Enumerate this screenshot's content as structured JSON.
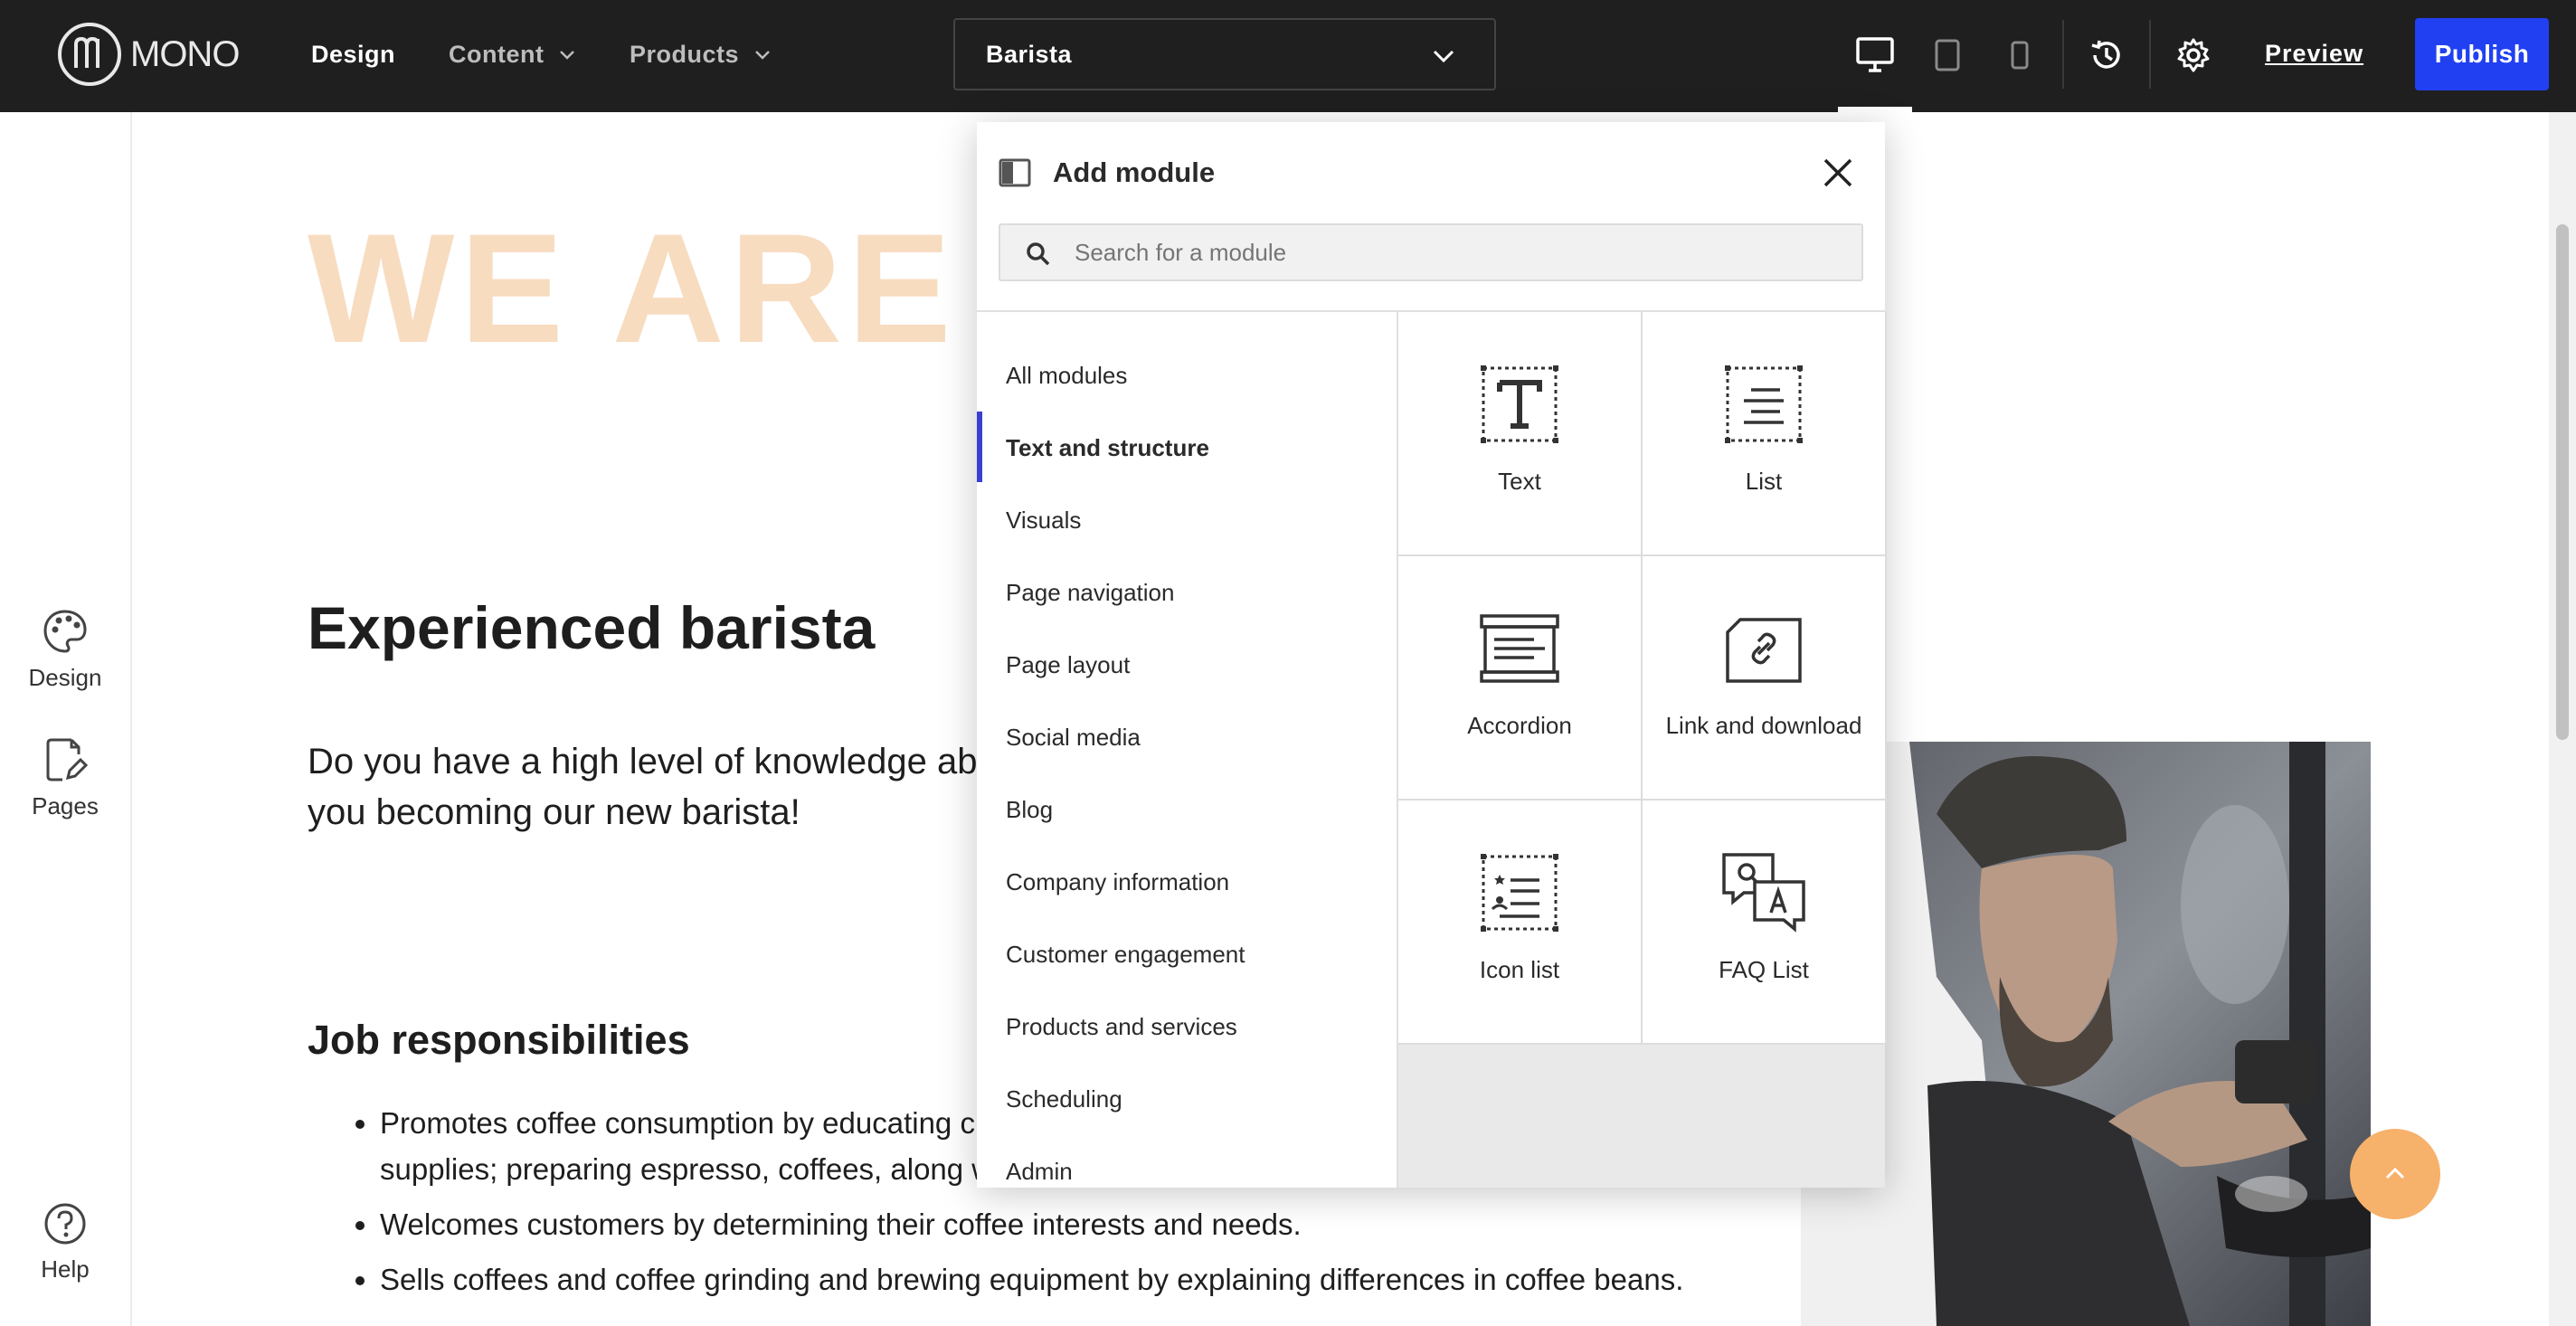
{
  "topbar": {
    "logo_text": "MONO",
    "nav": [
      {
        "label": "Design"
      },
      {
        "label": "Content"
      },
      {
        "label": "Products"
      }
    ],
    "page_select": "Barista",
    "preview_label": "Preview",
    "publish_label": "Publish"
  },
  "left_rail": {
    "design_label": "Design",
    "pages_label": "Pages",
    "help_label": "Help"
  },
  "page": {
    "hero_text": "WE ARE H",
    "job_title": "Experienced barista",
    "intro": "Do you have a high level of knowledge about coffee and good customer facing experience. We would love you becoming our new barista!",
    "resp_title": "Job responsibilities",
    "responsibilities": [
      "Promotes coffee consumption by educating customers; selling coffee, brewing equipment, accessories, and supplies; preparing espresso, coffees, along with pastries and cookies.",
      "Welcomes customers by determining their coffee interests and needs.",
      "Sells coffees and coffee grinding and brewing equipment by explaining differences in coffee beans."
    ]
  },
  "panel": {
    "title": "Add module",
    "search_placeholder": "Search for a module",
    "categories": [
      "All modules",
      "Text and structure",
      "Visuals",
      "Page navigation",
      "Page layout",
      "Social media",
      "Blog",
      "Company information",
      "Customer engagement",
      "Products and services",
      "Scheduling",
      "Admin"
    ],
    "active_category": "Text and structure",
    "modules": [
      {
        "label": "Text",
        "icon": "text-module-icon"
      },
      {
        "label": "List",
        "icon": "list-module-icon"
      },
      {
        "label": "Accordion",
        "icon": "accordion-module-icon"
      },
      {
        "label": "Link and download",
        "icon": "link-download-module-icon"
      },
      {
        "label": "Icon list",
        "icon": "icon-list-module-icon"
      },
      {
        "label": "FAQ List",
        "icon": "faq-list-module-icon"
      }
    ]
  },
  "colors": {
    "topbar_bg": "#1f1f1f",
    "publish_bg": "#2140f2",
    "active_category_bar": "#3a3fd4",
    "hero_text": "#f7dcc0",
    "scroll_top_button": "#f6b16b"
  }
}
